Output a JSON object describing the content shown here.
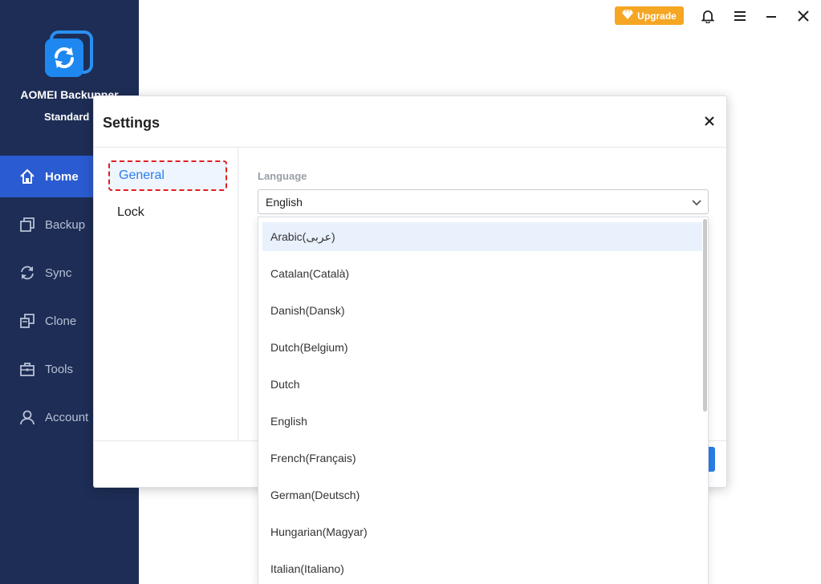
{
  "app": {
    "name": "AOMEI Backupper",
    "edition": "Standard"
  },
  "sidebar": {
    "items": [
      {
        "label": "Home",
        "icon": "home-icon",
        "active": true
      },
      {
        "label": "Backup",
        "icon": "backup-icon",
        "active": false
      },
      {
        "label": "Sync",
        "icon": "sync-icon",
        "active": false
      },
      {
        "label": "Clone",
        "icon": "clone-icon",
        "active": false
      },
      {
        "label": "Tools",
        "icon": "tools-icon",
        "active": false
      },
      {
        "label": "Account",
        "icon": "account-icon",
        "active": false
      }
    ]
  },
  "topbar": {
    "upgrade_label": "Upgrade",
    "icons": [
      "bell-icon",
      "menu-icon",
      "minimize-icon",
      "close-icon"
    ]
  },
  "settings": {
    "title": "Settings",
    "tabs": [
      {
        "label": "General",
        "selected": true
      },
      {
        "label": "Lock",
        "selected": false
      }
    ],
    "language_label": "Language",
    "language_selected": "English",
    "language_options": [
      "Arabic(عربى)",
      "Catalan(Català)",
      "Danish(Dansk)",
      "Dutch(Belgium)",
      "Dutch",
      "English",
      "French(Français)",
      "German(Deutsch)",
      "Hungarian(Magyar)",
      "Italian(Italiano)"
    ],
    "hovered_option_index": 0
  },
  "colors": {
    "sidebar_bg": "#1d2d55",
    "active_nav": "#2a5bd0",
    "accent": "#2b7de9",
    "upgrade": "#f5a623",
    "highlight_border": "#e02020"
  }
}
